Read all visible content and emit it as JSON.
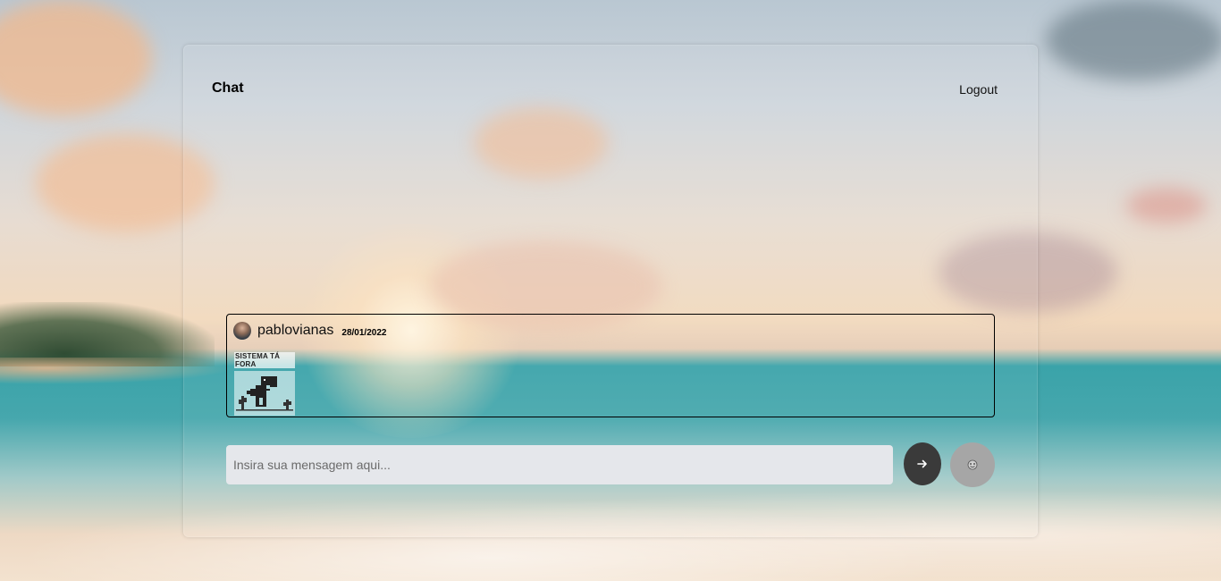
{
  "header": {
    "title": "Chat",
    "logout_label": "Logout"
  },
  "messages": [
    {
      "author": "pablovianas",
      "date": "28/01/2022",
      "sticker_caption": "SISTEMA TÁ FORA",
      "sticker_icon": "dinosaur-sticker"
    }
  ],
  "composer": {
    "placeholder": "Insira sua mensagem aqui...",
    "value": ""
  },
  "icons": {
    "send": "arrow-right-icon",
    "sticker": "sticker-emoji-icon"
  },
  "colors": {
    "send_button": "#3a3a3a",
    "sticker_button": "#a6a6a6",
    "composer_bg": "#e5e7eb",
    "message_border": "#000000"
  }
}
